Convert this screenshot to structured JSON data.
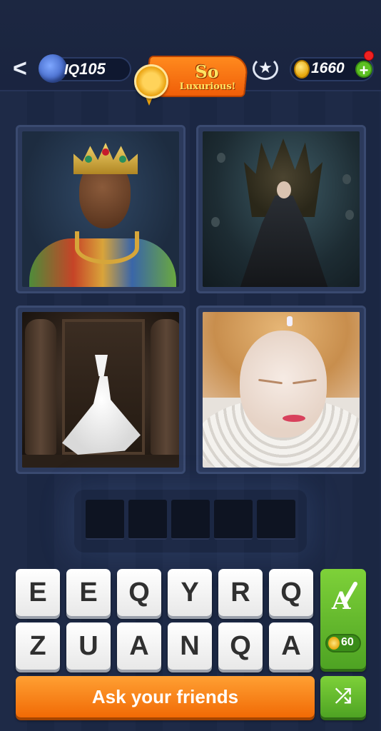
{
  "header": {
    "back_glyph": "<",
    "iq_label": "IQ",
    "iq_value": "105",
    "banner_line1": "So",
    "banner_line2": "Luxurious!",
    "coins": "1660",
    "add_glyph": "+"
  },
  "icons": {
    "back": "chevron-left-icon",
    "brain": "brain-icon",
    "medal": "medal-icon",
    "rank": "laurel-star-icon",
    "coin": "coin-icon",
    "add": "plus-icon",
    "hint": "brush-letter-icon",
    "shuffle": "shuffle-icon"
  },
  "puzzle": {
    "answer_slots": 5
  },
  "keyboard": {
    "row1": [
      "E",
      "E",
      "Q",
      "Y",
      "R",
      "Q"
    ],
    "row2": [
      "Z",
      "U",
      "A",
      "N",
      "Q",
      "A"
    ]
  },
  "hint": {
    "letter": "A",
    "cost": "60"
  },
  "actions": {
    "ask_friends": "Ask your friends",
    "shuffle_glyph": "⤮"
  },
  "colors": {
    "background": "#1a2540",
    "ask_button": "#f57a10",
    "hint_button": "#5cb82a",
    "banner": "#f26d0e"
  }
}
